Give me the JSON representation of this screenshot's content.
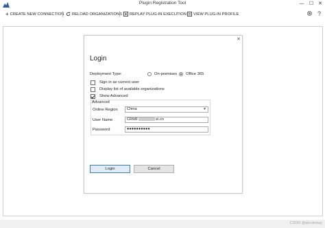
{
  "window": {
    "title": "Plugin Registration Tool",
    "minimize_glyph": "—",
    "maximize_glyph": "☐",
    "close_glyph": "✕"
  },
  "toolbar": {
    "create_connection": "CREATE NEW CONNECTION",
    "reload_organizations": "RELOAD ORGANIZATIONS",
    "replay_plugin_execution": "REPLAY PLUG-IN EXECUTION",
    "view_plugin_profile": "VIEW PLUG-IN PROFILE"
  },
  "login": {
    "close_glyph": "✕",
    "title": "Login",
    "deployment_type_label": "Deployment Type:",
    "deployment_options": [
      "On-premises",
      "Office 365"
    ],
    "selected_deployment": "Office 365",
    "sign_in_current_user": "Sign in as current user",
    "display_orgs": "Display list of available organizations",
    "show_advanced": "Show Advanced",
    "advanced": {
      "legend": "Advanced",
      "online_region_label": "Online Region",
      "online_region_value": "China",
      "user_name_label": "User Name",
      "user_name_prefix": "CRMF",
      "user_name_suffix": "ei.cn",
      "password_label": "Password",
      "password_mask": "●●●●●●●●●●"
    },
    "login_button": "Login",
    "cancel_button": "Cancel"
  },
  "status": {
    "watermark": "CSDN @abcdeway"
  },
  "colors": {
    "accent": "#3c7fb1",
    "logo": "#2b5a9e"
  }
}
